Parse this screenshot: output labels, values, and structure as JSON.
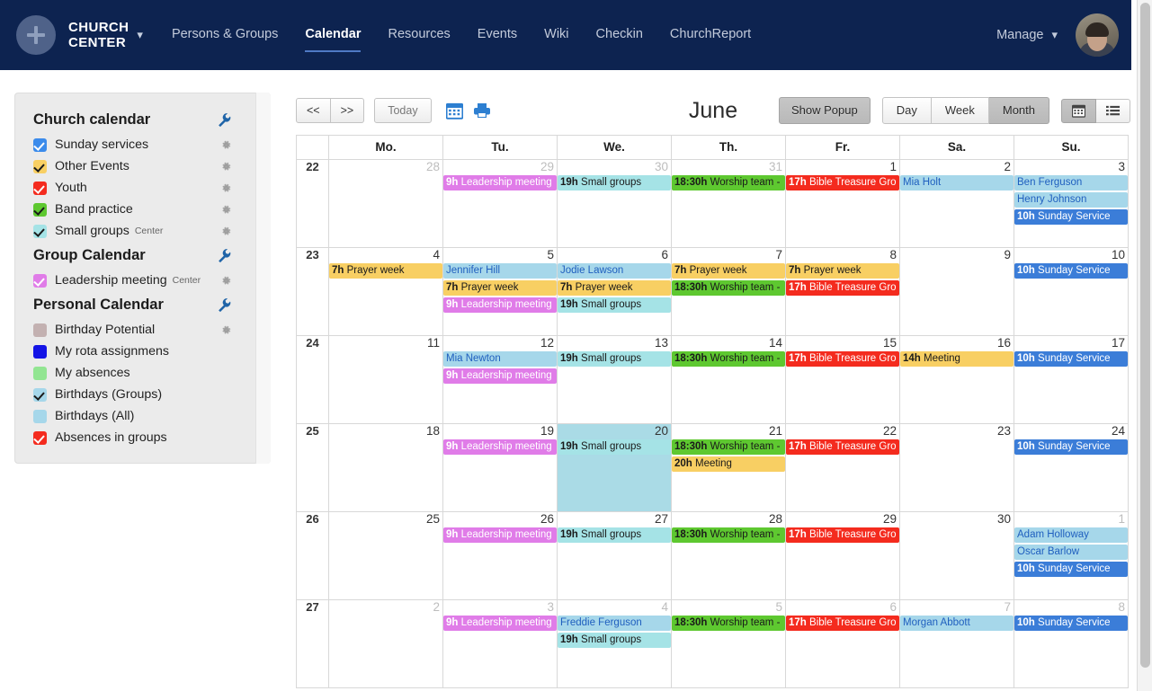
{
  "navbar": {
    "brand_line1": "CHURCH",
    "brand_line2": "CENTER",
    "brand_caret": "▾",
    "links": [
      {
        "label": "Persons & Groups",
        "active": false
      },
      {
        "label": "Calendar",
        "active": true
      },
      {
        "label": "Resources",
        "active": false
      },
      {
        "label": "Events",
        "active": false
      },
      {
        "label": "Wiki",
        "active": false
      },
      {
        "label": "Checkin",
        "active": false
      },
      {
        "label": "ChurchReport",
        "active": false
      }
    ],
    "manage_label": "Manage",
    "manage_caret": "▾"
  },
  "sidebar": {
    "sections": [
      {
        "title": "Church calendar",
        "items": [
          {
            "label": "Sunday services",
            "sub": "",
            "color": "#3b8beb",
            "checked": true,
            "check_dark": false,
            "gear": true
          },
          {
            "label": "Other Events",
            "sub": "",
            "color": "#f8cf63",
            "checked": true,
            "check_dark": true,
            "gear": true
          },
          {
            "label": "Youth",
            "sub": "",
            "color": "#f42b1e",
            "checked": true,
            "check_dark": false,
            "gear": true
          },
          {
            "label": "Band practice",
            "sub": "",
            "color": "#5ec830",
            "checked": true,
            "check_dark": true,
            "gear": true
          },
          {
            "label": "Small groups",
            "sub": "Center",
            "color": "#a5e3e6",
            "checked": true,
            "check_dark": true,
            "gear": true
          }
        ]
      },
      {
        "title": "Group Calendar",
        "items": [
          {
            "label": "Leadership meeting",
            "sub": "Center",
            "color": "#e07ce8",
            "checked": true,
            "check_dark": false,
            "gear": true
          }
        ]
      },
      {
        "title": "Personal Calendar",
        "items": [
          {
            "label": "Birthday Potential",
            "sub": "",
            "color": "#c3b1b1",
            "checked": false,
            "check_dark": false,
            "gear": true
          },
          {
            "label": "My rota assignmens",
            "sub": "",
            "color": "#1414e6",
            "checked": false,
            "check_dark": false,
            "gear": false
          },
          {
            "label": "My absences",
            "sub": "",
            "color": "#92e592",
            "checked": false,
            "check_dark": false,
            "gear": false
          },
          {
            "label": "Birthdays (Groups)",
            "sub": "",
            "color": "#a6d7ea",
            "checked": true,
            "check_dark": true,
            "gear": false
          },
          {
            "label": "Birthdays (All)",
            "sub": "",
            "color": "#a6d7ea",
            "checked": false,
            "check_dark": false,
            "gear": false
          },
          {
            "label": "Absences in groups",
            "sub": "",
            "color": "#f42b1e",
            "checked": true,
            "check_dark": false,
            "gear": false
          }
        ]
      }
    ]
  },
  "toolbar": {
    "prev_label": "<<",
    "next_label": ">>",
    "today_label": "Today",
    "month_title": "June",
    "show_popup_label": "Show Popup",
    "day_label": "Day",
    "week_label": "Week",
    "month_label": "Month"
  },
  "calendar": {
    "weekday_headers": [
      "Mo.",
      "Tu.",
      "We.",
      "Th.",
      "Fr.",
      "Sa.",
      "Su."
    ],
    "weeks": [
      {
        "week_number": "22",
        "days": [
          {
            "num": "28",
            "other_month": true,
            "today": false,
            "events": []
          },
          {
            "num": "29",
            "other_month": true,
            "today": false,
            "events": [
              {
                "time": "9h",
                "title": "Leadership meeting",
                "bg": "#e07ce8",
                "fg": "#ffffff"
              }
            ]
          },
          {
            "num": "30",
            "other_month": true,
            "today": false,
            "events": [
              {
                "time": "19h",
                "title": "Small groups",
                "bg": "#a5e3e6",
                "fg": "#1a1a1a"
              }
            ]
          },
          {
            "num": "31",
            "other_month": true,
            "today": false,
            "events": [
              {
                "time": "18:30h",
                "title": "Worship team -",
                "bg": "#5ec830",
                "fg": "#1a1a1a"
              }
            ]
          },
          {
            "num": "1",
            "other_month": false,
            "today": false,
            "events": [
              {
                "time": "17h",
                "title": "Bible Treasure Gro",
                "bg": "#f42b1e",
                "fg": "#ffffff"
              }
            ]
          },
          {
            "num": "2",
            "other_month": false,
            "today": false,
            "events": [
              {
                "time": "",
                "title": "Mia Holt",
                "bg": "#a6d7ea",
                "fg": "#1f5fbf"
              }
            ]
          },
          {
            "num": "3",
            "other_month": false,
            "today": false,
            "events": [
              {
                "time": "",
                "title": "Ben Ferguson",
                "bg": "#a6d7ea",
                "fg": "#1f5fbf"
              },
              {
                "time": "",
                "title": "Henry Johnson",
                "bg": "#a6d7ea",
                "fg": "#1f5fbf"
              },
              {
                "time": "10h",
                "title": "Sunday Service",
                "bg": "#3b7dd8",
                "fg": "#ffffff"
              }
            ]
          }
        ]
      },
      {
        "week_number": "23",
        "days": [
          {
            "num": "4",
            "other_month": false,
            "today": false,
            "events": [
              {
                "time": "7h",
                "title": "Prayer week",
                "bg": "#f8cf63",
                "fg": "#1a1a1a"
              }
            ]
          },
          {
            "num": "5",
            "other_month": false,
            "today": false,
            "events": [
              {
                "time": "",
                "title": "Jennifer Hill",
                "bg": "#a6d7ea",
                "fg": "#1f5fbf"
              },
              {
                "time": "7h",
                "title": "Prayer week",
                "bg": "#f8cf63",
                "fg": "#1a1a1a"
              },
              {
                "time": "9h",
                "title": "Leadership meeting",
                "bg": "#e07ce8",
                "fg": "#ffffff"
              }
            ]
          },
          {
            "num": "6",
            "other_month": false,
            "today": false,
            "events": [
              {
                "time": "",
                "title": "Jodie Lawson",
                "bg": "#a6d7ea",
                "fg": "#1f5fbf"
              },
              {
                "time": "7h",
                "title": "Prayer week",
                "bg": "#f8cf63",
                "fg": "#1a1a1a"
              },
              {
                "time": "19h",
                "title": "Small groups",
                "bg": "#a5e3e6",
                "fg": "#1a1a1a"
              }
            ]
          },
          {
            "num": "7",
            "other_month": false,
            "today": false,
            "events": [
              {
                "time": "7h",
                "title": "Prayer week",
                "bg": "#f8cf63",
                "fg": "#1a1a1a"
              },
              {
                "time": "18:30h",
                "title": "Worship team -",
                "bg": "#5ec830",
                "fg": "#1a1a1a"
              }
            ]
          },
          {
            "num": "8",
            "other_month": false,
            "today": false,
            "events": [
              {
                "time": "7h",
                "title": "Prayer week",
                "bg": "#f8cf63",
                "fg": "#1a1a1a"
              },
              {
                "time": "17h",
                "title": "Bible Treasure Gro",
                "bg": "#f42b1e",
                "fg": "#ffffff"
              }
            ]
          },
          {
            "num": "9",
            "other_month": false,
            "today": false,
            "events": []
          },
          {
            "num": "10",
            "other_month": false,
            "today": false,
            "events": [
              {
                "time": "10h",
                "title": "Sunday Service",
                "bg": "#3b7dd8",
                "fg": "#ffffff"
              }
            ]
          }
        ]
      },
      {
        "week_number": "24",
        "days": [
          {
            "num": "11",
            "other_month": false,
            "today": false,
            "events": []
          },
          {
            "num": "12",
            "other_month": false,
            "today": false,
            "events": [
              {
                "time": "",
                "title": "Mia Newton",
                "bg": "#a6d7ea",
                "fg": "#1f5fbf"
              },
              {
                "time": "9h",
                "title": "Leadership meeting",
                "bg": "#e07ce8",
                "fg": "#ffffff"
              }
            ]
          },
          {
            "num": "13",
            "other_month": false,
            "today": false,
            "events": [
              {
                "time": "19h",
                "title": "Small groups",
                "bg": "#a5e3e6",
                "fg": "#1a1a1a"
              }
            ]
          },
          {
            "num": "14",
            "other_month": false,
            "today": false,
            "events": [
              {
                "time": "18:30h",
                "title": "Worship team -",
                "bg": "#5ec830",
                "fg": "#1a1a1a"
              }
            ]
          },
          {
            "num": "15",
            "other_month": false,
            "today": false,
            "events": [
              {
                "time": "17h",
                "title": "Bible Treasure Gro",
                "bg": "#f42b1e",
                "fg": "#ffffff"
              }
            ]
          },
          {
            "num": "16",
            "other_month": false,
            "today": false,
            "events": [
              {
                "time": "14h",
                "title": "Meeting",
                "bg": "#f8cf63",
                "fg": "#1a1a1a"
              }
            ]
          },
          {
            "num": "17",
            "other_month": false,
            "today": false,
            "events": [
              {
                "time": "10h",
                "title": "Sunday Service",
                "bg": "#3b7dd8",
                "fg": "#ffffff"
              }
            ]
          }
        ]
      },
      {
        "week_number": "25",
        "days": [
          {
            "num": "18",
            "other_month": false,
            "today": false,
            "events": []
          },
          {
            "num": "19",
            "other_month": false,
            "today": false,
            "events": [
              {
                "time": "9h",
                "title": "Leadership meeting",
                "bg": "#e07ce8",
                "fg": "#ffffff"
              }
            ]
          },
          {
            "num": "20",
            "other_month": false,
            "today": true,
            "events": [
              {
                "time": "19h",
                "title": "Small groups",
                "bg": "#a5e3e6",
                "fg": "#1a1a1a"
              }
            ]
          },
          {
            "num": "21",
            "other_month": false,
            "today": false,
            "events": [
              {
                "time": "18:30h",
                "title": "Worship team -",
                "bg": "#5ec830",
                "fg": "#1a1a1a"
              },
              {
                "time": "20h",
                "title": "Meeting",
                "bg": "#f8cf63",
                "fg": "#1a1a1a"
              }
            ]
          },
          {
            "num": "22",
            "other_month": false,
            "today": false,
            "events": [
              {
                "time": "17h",
                "title": "Bible Treasure Gro",
                "bg": "#f42b1e",
                "fg": "#ffffff"
              }
            ]
          },
          {
            "num": "23",
            "other_month": false,
            "today": false,
            "events": []
          },
          {
            "num": "24",
            "other_month": false,
            "today": false,
            "events": [
              {
                "time": "10h",
                "title": "Sunday Service",
                "bg": "#3b7dd8",
                "fg": "#ffffff"
              }
            ]
          }
        ]
      },
      {
        "week_number": "26",
        "days": [
          {
            "num": "25",
            "other_month": false,
            "today": false,
            "events": []
          },
          {
            "num": "26",
            "other_month": false,
            "today": false,
            "events": [
              {
                "time": "9h",
                "title": "Leadership meeting",
                "bg": "#e07ce8",
                "fg": "#ffffff"
              }
            ]
          },
          {
            "num": "27",
            "other_month": false,
            "today": false,
            "events": [
              {
                "time": "19h",
                "title": "Small groups",
                "bg": "#a5e3e6",
                "fg": "#1a1a1a"
              }
            ]
          },
          {
            "num": "28",
            "other_month": false,
            "today": false,
            "events": [
              {
                "time": "18:30h",
                "title": "Worship team -",
                "bg": "#5ec830",
                "fg": "#1a1a1a"
              }
            ]
          },
          {
            "num": "29",
            "other_month": false,
            "today": false,
            "events": [
              {
                "time": "17h",
                "title": "Bible Treasure Gro",
                "bg": "#f42b1e",
                "fg": "#ffffff"
              }
            ]
          },
          {
            "num": "30",
            "other_month": false,
            "today": false,
            "events": []
          },
          {
            "num": "1",
            "other_month": true,
            "today": false,
            "events": [
              {
                "time": "",
                "title": "Adam Holloway",
                "bg": "#a6d7ea",
                "fg": "#1f5fbf"
              },
              {
                "time": "",
                "title": "Oscar Barlow",
                "bg": "#a6d7ea",
                "fg": "#1f5fbf"
              },
              {
                "time": "10h",
                "title": "Sunday Service",
                "bg": "#3b7dd8",
                "fg": "#ffffff"
              }
            ]
          }
        ]
      },
      {
        "week_number": "27",
        "days": [
          {
            "num": "2",
            "other_month": true,
            "today": false,
            "events": []
          },
          {
            "num": "3",
            "other_month": true,
            "today": false,
            "events": [
              {
                "time": "9h",
                "title": "Leadership meeting",
                "bg": "#e07ce8",
                "fg": "#ffffff"
              }
            ]
          },
          {
            "num": "4",
            "other_month": true,
            "today": false,
            "events": [
              {
                "time": "",
                "title": "Freddie Ferguson",
                "bg": "#a6d7ea",
                "fg": "#1f5fbf"
              },
              {
                "time": "19h",
                "title": "Small groups",
                "bg": "#a5e3e6",
                "fg": "#1a1a1a"
              }
            ]
          },
          {
            "num": "5",
            "other_month": true,
            "today": false,
            "events": [
              {
                "time": "18:30h",
                "title": "Worship team -",
                "bg": "#5ec830",
                "fg": "#1a1a1a"
              }
            ]
          },
          {
            "num": "6",
            "other_month": true,
            "today": false,
            "events": [
              {
                "time": "17h",
                "title": "Bible Treasure Gro",
                "bg": "#f42b1e",
                "fg": "#ffffff"
              }
            ]
          },
          {
            "num": "7",
            "other_month": true,
            "today": false,
            "events": [
              {
                "time": "",
                "title": "Morgan Abbott",
                "bg": "#a6d7ea",
                "fg": "#1f5fbf"
              }
            ]
          },
          {
            "num": "8",
            "other_month": true,
            "today": false,
            "events": [
              {
                "time": "10h",
                "title": "Sunday Service",
                "bg": "#3b7dd8",
                "fg": "#ffffff"
              }
            ]
          }
        ]
      }
    ]
  }
}
